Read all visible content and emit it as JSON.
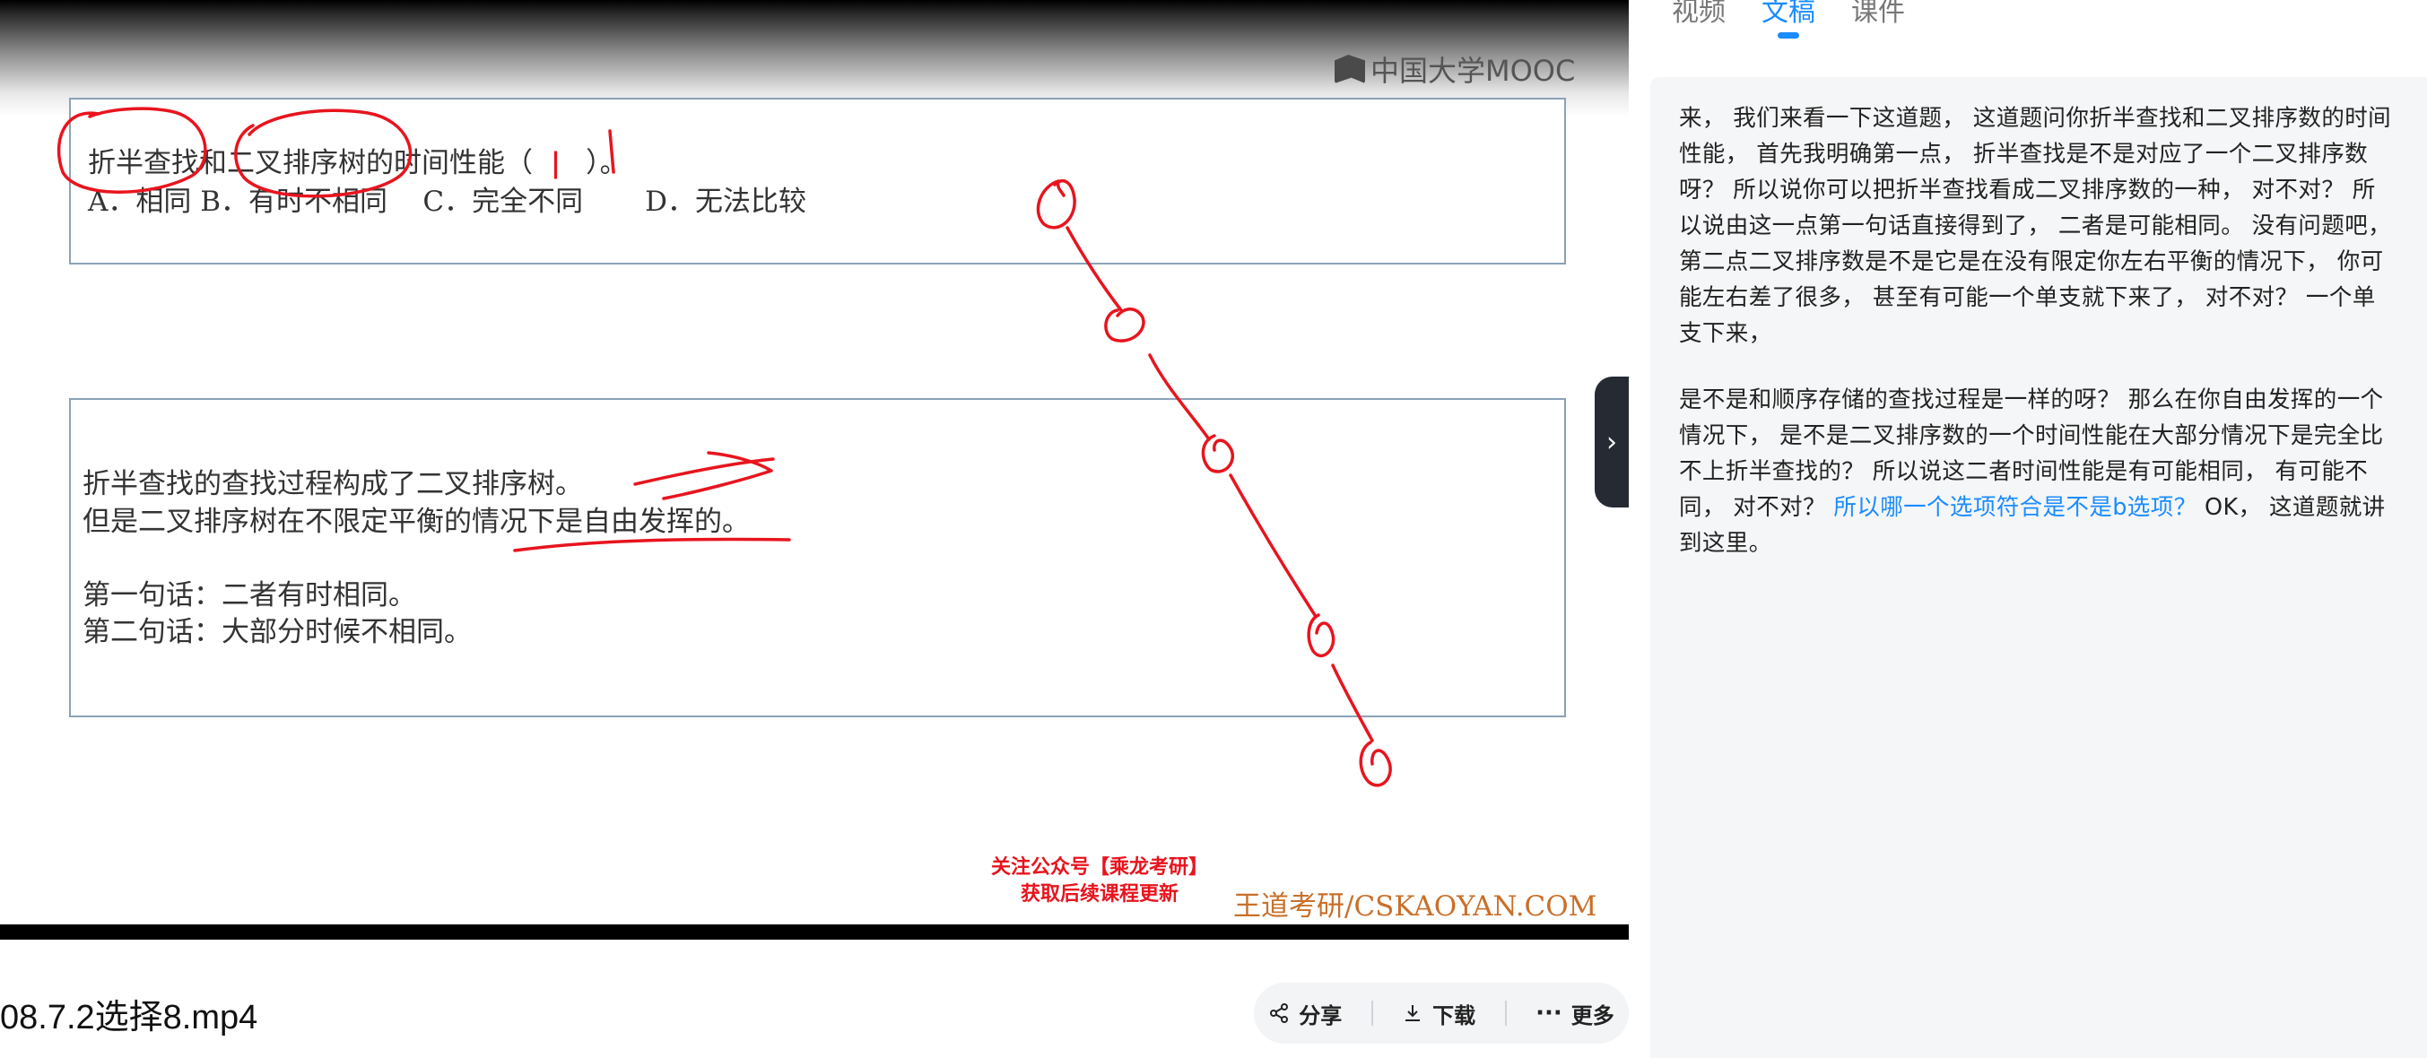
{
  "video": {
    "logo_text": "中国大学MOOC",
    "question": {
      "stem_parts": [
        "折半查找和二叉排序树的时间性能（ ",
        "）。"
      ],
      "answer_mark": "|",
      "options": "A．相同 B．有时不相同    C．完全不同       D．无法比较"
    },
    "explanation": {
      "line1": "折半查找的查找过程构成了二叉排序树。",
      "line2": "但是二叉排序树在不限定平衡的情况下是自由发挥的。",
      "line3": "第一句话：二者有时相同。",
      "line4": "第二句话：大部分时候不相同。"
    },
    "promo_line1": "关注公众号【乘龙考研】",
    "promo_line2": "获取后续课程更新",
    "watermark_brand": "王道考研",
    "watermark_site": "/CSKAOYAN.COM"
  },
  "file": {
    "name": "08.7.2选择8.mp4"
  },
  "actions": [
    {
      "label": "分享",
      "icon": "share-icon"
    },
    {
      "label": "下载",
      "icon": "download-icon"
    },
    {
      "label": "更多",
      "icon": "more-icon"
    }
  ],
  "tabs": [
    {
      "label": "视频",
      "active": false
    },
    {
      "label": "文稿",
      "active": true
    },
    {
      "label": "课件",
      "active": false
    }
  ],
  "transcript": {
    "para1": "来， 我们来看一下这道题， 这道题问你折半查找和二叉排序数的时间性能， 首先我明确第一点， 折半查找是不是对应了一个二叉排序数呀？ 所以说你可以把折半查找看成二叉排序数的一种， 对不对？ 所以说由这一点第一句话直接得到了， 二者是可能相同。 没有问题吧， 第二点二叉排序数是不是它是在没有限定你左右平衡的情况下， 你可能左右差了很多， 甚至有可能一个单支就下来了， 对不对？ 一个单支下来，",
    "para2_start": "是不是和顺序存储的查找过程是一样的呀？ 那么在你自由发挥的一个情况下， 是不是二叉排序数的一个时间性能在大部分情况下是完全比不上折半查找的？ 所以说这二者时间性能是有可能相同， 有可能不同， 对不对？ ",
    "para2_highlight": "所以哪一个选项符合是不是b选项？",
    "para2_end": " OK， 这道题就讲到这里。"
  },
  "colors": {
    "accent": "#1a8cff",
    "ink_red": "#e8141e",
    "panel_bg": "#f5f6f7"
  }
}
